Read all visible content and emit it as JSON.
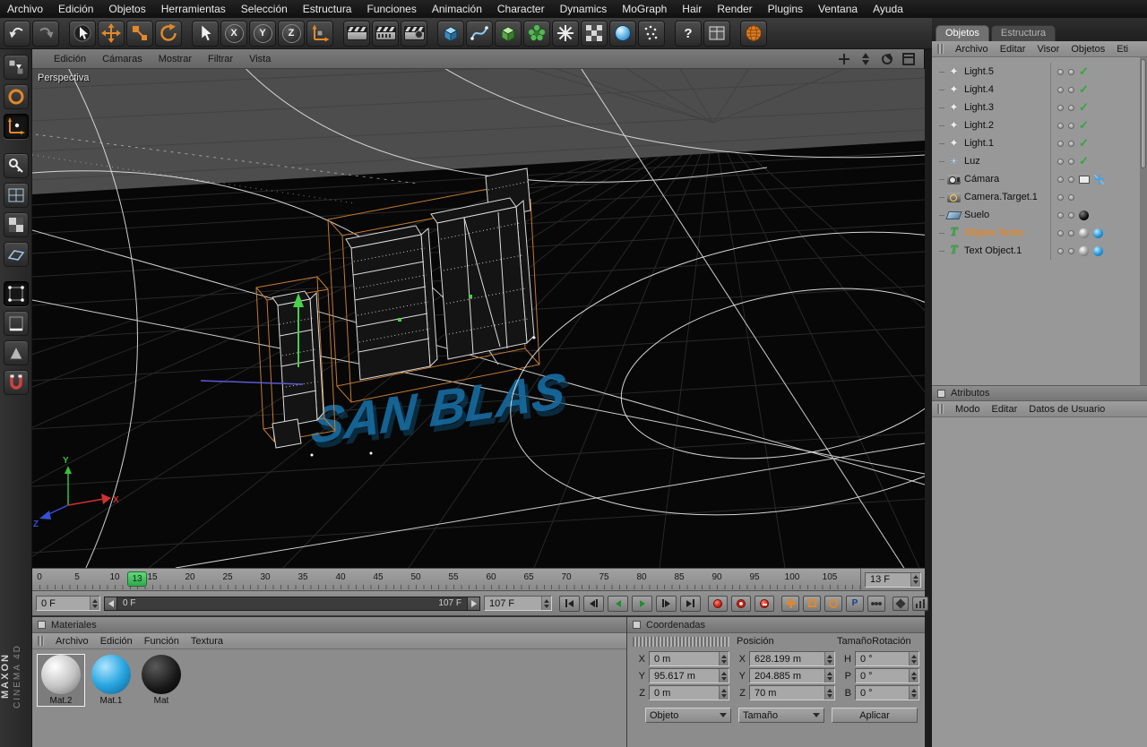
{
  "menubar": {
    "items": [
      "Archivo",
      "Edición",
      "Objetos",
      "Herramientas",
      "Selección",
      "Estructura",
      "Funciones",
      "Animación",
      "Character",
      "Dynamics",
      "MoGraph",
      "Hair",
      "Render",
      "Plugins",
      "Ventana",
      "Ayuda"
    ]
  },
  "toolbar": {
    "axis_x": "X",
    "axis_y": "Y",
    "axis_z": "Z",
    "help_label": "?"
  },
  "viewport": {
    "menu": [
      "Edición",
      "Cámaras",
      "Mostrar",
      "Filtrar",
      "Vista"
    ],
    "view_label": "Perspectiva",
    "scene_text": "SAN BLAS",
    "axis_labels": {
      "x": "X",
      "y": "Y",
      "z": "Z"
    }
  },
  "object_manager": {
    "tabs": [
      {
        "label": "Objetos"
      },
      {
        "label": "Estructura"
      }
    ],
    "menu": [
      "Archivo",
      "Editar",
      "Visor",
      "Objetos",
      "Eti"
    ],
    "objects": [
      {
        "name": "Light.5",
        "icon": "spotlight"
      },
      {
        "name": "Light.4",
        "icon": "spotlight"
      },
      {
        "name": "Light.3",
        "icon": "spotlight"
      },
      {
        "name": "Light.2",
        "icon": "spotlight"
      },
      {
        "name": "Light.1",
        "icon": "spotlight"
      },
      {
        "name": "Luz",
        "icon": "omni-light"
      },
      {
        "name": "Cámara",
        "icon": "camera"
      },
      {
        "name": "Camera.Target.1",
        "icon": "camera-target"
      },
      {
        "name": "Suelo",
        "icon": "floor"
      },
      {
        "name": "Objeto Texto",
        "icon": "text-spline",
        "selected": true
      },
      {
        "name": "Text Object.1",
        "icon": "text-spline"
      }
    ]
  },
  "attributes_panel": {
    "title": "Atributos",
    "menu": [
      "Modo",
      "Editar",
      "Datos de Usuario"
    ]
  },
  "timeline": {
    "tick_labels": [
      "0",
      "5",
      "10",
      "15",
      "20",
      "25",
      "30",
      "35",
      "40",
      "45",
      "50",
      "55",
      "60",
      "65",
      "70",
      "75",
      "80",
      "85",
      "90",
      "95",
      "100",
      "105"
    ],
    "current_frame": "13",
    "frame_field": "13 F",
    "start_field": "0 F",
    "end_field": "107 F",
    "range_start_label": "0 F",
    "range_end_label": "107 F"
  },
  "transport": {
    "param_label": "P"
  },
  "materials_panel": {
    "title": "Materiales",
    "menu": [
      "Archivo",
      "Edición",
      "Función",
      "Textura"
    ],
    "items": [
      {
        "name": "Mat.2",
        "color": "#e9e9e9"
      },
      {
        "name": "Mat.1",
        "color": "#1f9ad6"
      },
      {
        "name": "Mat",
        "color": "#141414"
      }
    ]
  },
  "coordinates_panel": {
    "title": "Coordenadas",
    "columns": [
      "Posición",
      "Tamaño",
      "Rotación"
    ],
    "rows": [
      {
        "pos_label": "X",
        "pos_value": "0 m",
        "size_label": "X",
        "size_value": "628.199 m",
        "rot_label": "H",
        "rot_value": "0 °"
      },
      {
        "pos_label": "Y",
        "pos_value": "95.617 m",
        "size_label": "Y",
        "size_value": "204.885 m",
        "rot_label": "P",
        "rot_value": "0 °"
      },
      {
        "pos_label": "Z",
        "pos_value": "0 m",
        "size_label": "Z",
        "size_value": "70 m",
        "rot_label": "B",
        "rot_value": "0 °"
      }
    ],
    "mode_dropdown": "Objeto",
    "size_dropdown": "Tamaño",
    "apply_label": "Aplicar"
  },
  "branding": {
    "line1": "MAXON",
    "line2": "CINEMA 4D"
  }
}
